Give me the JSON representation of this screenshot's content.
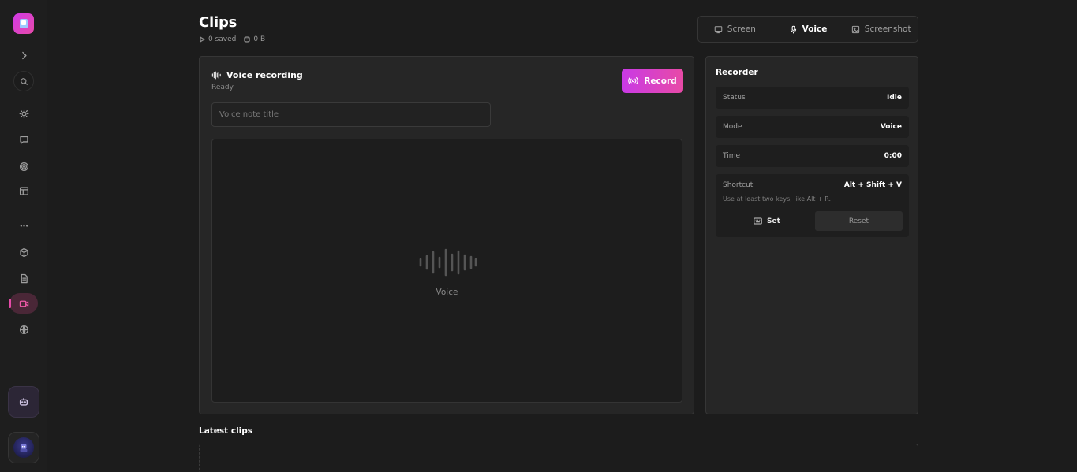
{
  "sidebar": {
    "logo_icon": "app-logo-icon",
    "items": [
      {
        "icon": "chevron-right-icon"
      },
      {
        "icon": "search-icon"
      },
      {
        "icon": "sun-icon"
      },
      {
        "icon": "message-icon"
      },
      {
        "icon": "target-icon"
      },
      {
        "icon": "layout-icon"
      },
      {
        "icon": "more-horizontal-icon"
      },
      {
        "icon": "cube-icon"
      },
      {
        "icon": "document-icon"
      },
      {
        "icon": "video-icon",
        "active": true
      },
      {
        "icon": "globe-icon"
      }
    ],
    "bot_icon": "robot-icon",
    "avatar_icon": "avatar-icon"
  },
  "header": {
    "title": "Clips",
    "saved_count": "0 saved",
    "storage_used": "0 B"
  },
  "mode_tabs": [
    {
      "label": "Screen",
      "icon": "monitor-icon",
      "active": false
    },
    {
      "label": "Voice",
      "icon": "microphone-icon",
      "active": true
    },
    {
      "label": "Screenshot",
      "icon": "image-icon",
      "active": false
    }
  ],
  "voice_panel": {
    "title": "Voice recording",
    "status": "Ready",
    "record_label": "Record",
    "title_input": {
      "value": "",
      "placeholder": "Voice note title"
    },
    "stage_label": "Voice"
  },
  "recorder": {
    "title": "Recorder",
    "rows": [
      {
        "label": "Status",
        "value": "Idle"
      },
      {
        "label": "Mode",
        "value": "Voice"
      },
      {
        "label": "Time",
        "value": "0:00"
      }
    ],
    "shortcut": {
      "label": "Shortcut",
      "value": "Alt + Shift + V",
      "hint": "Use at least two keys, like Alt + R.",
      "set_label": "Set",
      "reset_label": "Reset"
    }
  },
  "latest_clips": {
    "title": "Latest clips"
  },
  "colors": {
    "accent_start": "#c93ae6",
    "accent_end": "#e84aa6",
    "background": "#1c1c1c",
    "panel": "#262626"
  }
}
